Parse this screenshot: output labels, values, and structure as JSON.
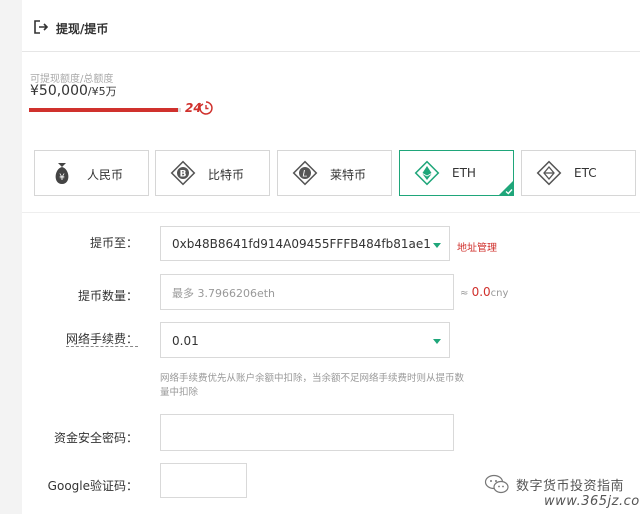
{
  "header": {
    "title": "提现/提币",
    "exit_icon": "exit-icon"
  },
  "quota": {
    "label": "可提现额度/总额度",
    "available": "¥50,000",
    "total": "/¥5万",
    "progress_fraction": 0.98,
    "badge_text": "24",
    "badge_icon": "clock-refresh-icon"
  },
  "currency_tabs": [
    {
      "label": "人民币",
      "icon": "money-bag-icon",
      "active": false
    },
    {
      "label": "比特币",
      "icon": "bitcoin-icon",
      "active": false
    },
    {
      "label": "莱特币",
      "icon": "litecoin-icon",
      "active": false
    },
    {
      "label": "ETH",
      "icon": "ethereum-icon",
      "active": true
    },
    {
      "label": "ETC",
      "icon": "ethereum-classic-icon",
      "active": false
    }
  ],
  "form": {
    "address": {
      "label": "提币至：",
      "value": "0xb48B8641fd914A09455FFFB484fb81ae1",
      "link": "地址管理"
    },
    "amount": {
      "label": "提币数量：",
      "placeholder": "最多 3.7966206eth",
      "approx_prefix": "≈",
      "approx_value": "0.0",
      "approx_unit": "cny"
    },
    "fee": {
      "label": "网络手续费：",
      "value": "0.01",
      "hint": "网络手续费优先从账户余额中扣除，当余额不足网络手续费时则从提币数量中扣除"
    },
    "password": {
      "label": "资金安全密码：",
      "value": ""
    },
    "google": {
      "label": "Google验证码：",
      "value": ""
    }
  },
  "watermark": {
    "text": "数字货币投资指南",
    "url": "www.365jz.com"
  },
  "colors": {
    "accent_green": "#1fa67a",
    "accent_red": "#d0312d",
    "border": "#d9d9d9"
  }
}
